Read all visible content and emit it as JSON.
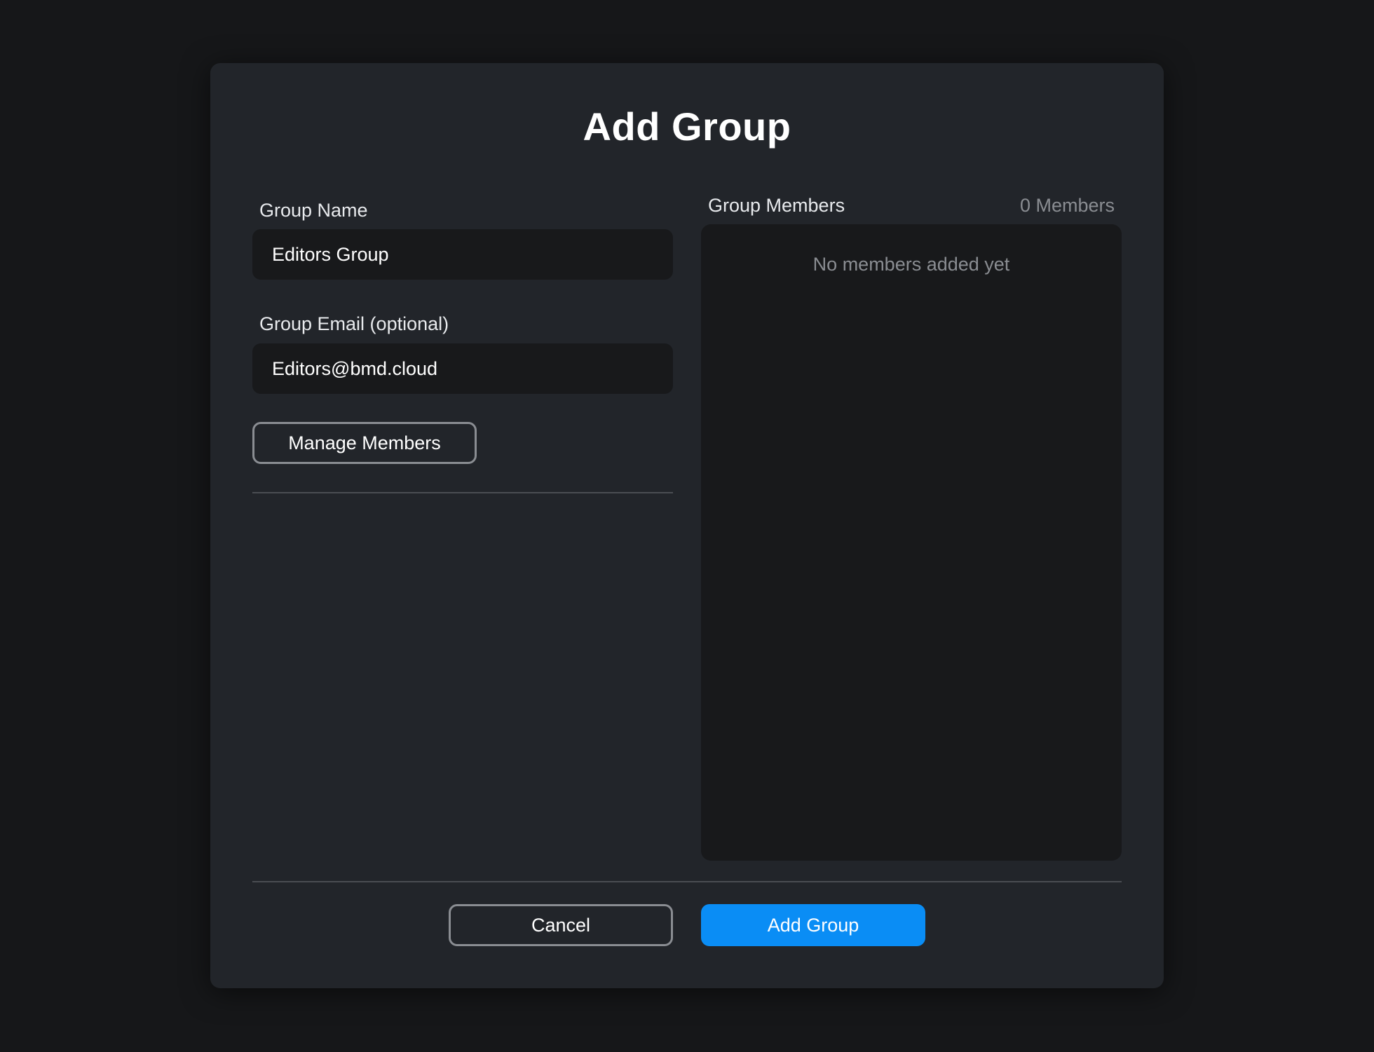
{
  "dialog": {
    "title": "Add Group"
  },
  "form": {
    "group_name_label": "Group Name",
    "group_name_value": "Editors Group",
    "group_email_label": "Group Email (optional)",
    "group_email_value": "Editors@bmd.cloud",
    "manage_members_label": "Manage Members"
  },
  "members": {
    "header_label": "Group Members",
    "count_label": "0 Members",
    "empty_message": "No members added yet"
  },
  "footer": {
    "cancel_label": "Cancel",
    "submit_label": "Add Group"
  },
  "colors": {
    "background": "#161719",
    "dialog": "#22252a",
    "input": "#18191b",
    "accent": "#0a8df5",
    "muted_text": "#8a8d92"
  }
}
